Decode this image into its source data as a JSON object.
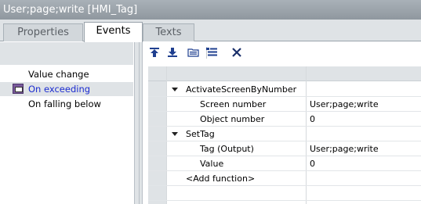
{
  "window": {
    "title": "User;page;write [HMI_Tag]"
  },
  "tabs": [
    {
      "label": "Properties"
    },
    {
      "label": "Events"
    },
    {
      "label": "Texts"
    }
  ],
  "events": [
    {
      "label": "Value change",
      "selected": false
    },
    {
      "label": "On exceeding",
      "selected": true
    },
    {
      "label": "On falling below",
      "selected": false
    }
  ],
  "toolbar": {
    "icons": [
      "move-up-icon",
      "move-down-icon",
      "folder-open-icon",
      "list-icon",
      "delete-icon"
    ]
  },
  "functions": [
    {
      "name": "ActivateScreenByNumber",
      "params": [
        {
          "label": "Screen number",
          "value": "User;page;write"
        },
        {
          "label": "Object number",
          "value": "0"
        }
      ]
    },
    {
      "name": "SetTag",
      "params": [
        {
          "label": "Tag (Output)",
          "value": "User;page;write"
        },
        {
          "label": "Value",
          "value": "0"
        }
      ]
    }
  ],
  "add_function": "<Add function>",
  "colors": {
    "selected_text": "#1b2bd0",
    "panel_bg": "#dfe3e6",
    "titlebar": "#9aa2aa"
  }
}
